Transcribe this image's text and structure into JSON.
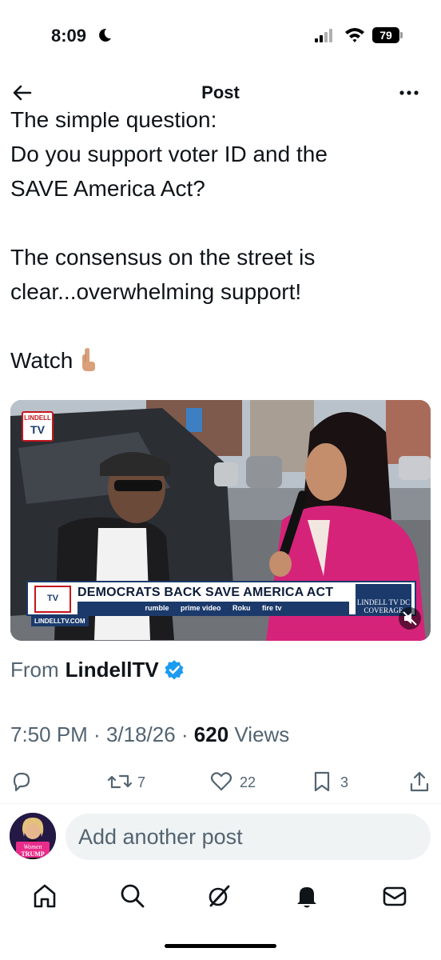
{
  "status_bar": {
    "time": "8:09",
    "battery": "79"
  },
  "header": {
    "title": "Post"
  },
  "post": {
    "lines": [
      "The simple question:",
      "Do you support voter ID and the",
      "SAVE America Act?",
      "The consensus on the street is",
      "clear...overwhelming support!",
      "Watch"
    ]
  },
  "video": {
    "channel_logo_top": "LINDELL",
    "channel_logo_bottom": "TV",
    "headline": "DEMOCRATS BACK SAVE AMERICA ACT",
    "partners": [
      "rumble",
      "prime video",
      "Roku",
      "fire tv"
    ],
    "right_badge": "LINDELL TV DC COVERAGE",
    "site_url": "LINDELLTV.COM"
  },
  "source": {
    "prefix": "From",
    "name": "LindellTV"
  },
  "meta": {
    "time": "7:50 PM",
    "date": "3/18/26",
    "views_count": "620",
    "views_label": "Views"
  },
  "actions": {
    "reposts": "7",
    "likes": "22",
    "bookmarks": "3"
  },
  "reply": {
    "placeholder": "Add another post",
    "avatar_caption_1": "Women",
    "avatar_caption_2": "TRUMP"
  },
  "colors": {
    "accent": "#1d9bf0",
    "text_primary": "#0f1419",
    "text_secondary": "#536471",
    "reply_bg": "#eff3f4"
  }
}
